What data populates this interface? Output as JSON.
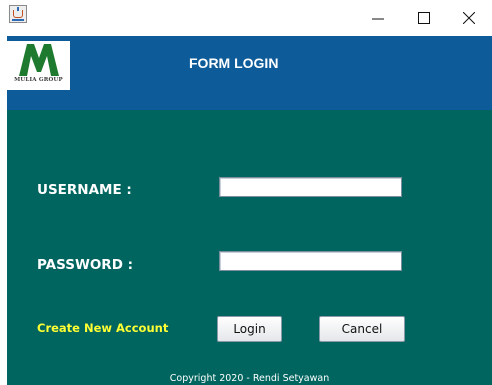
{
  "window": {
    "app_icon": "java-cup-icon",
    "controls": [
      "minimize-icon",
      "maximize-icon",
      "close-icon"
    ]
  },
  "header": {
    "logo_text": "MULIA GROUP",
    "logo_color": "#1e7a2e",
    "title": "FORM LOGIN",
    "background": "#0e5b99"
  },
  "form": {
    "background": "#01655f",
    "username_label": "USERNAME  :",
    "username_value": "",
    "password_label": "PASSWORD  :",
    "password_value": "",
    "create_account_label": "Create New Account",
    "create_account_color": "#ffff33",
    "login_label": "Login",
    "cancel_label": "Cancel"
  },
  "footer": {
    "copyright": "Copyright 2020 - Rendi Setyawan"
  }
}
